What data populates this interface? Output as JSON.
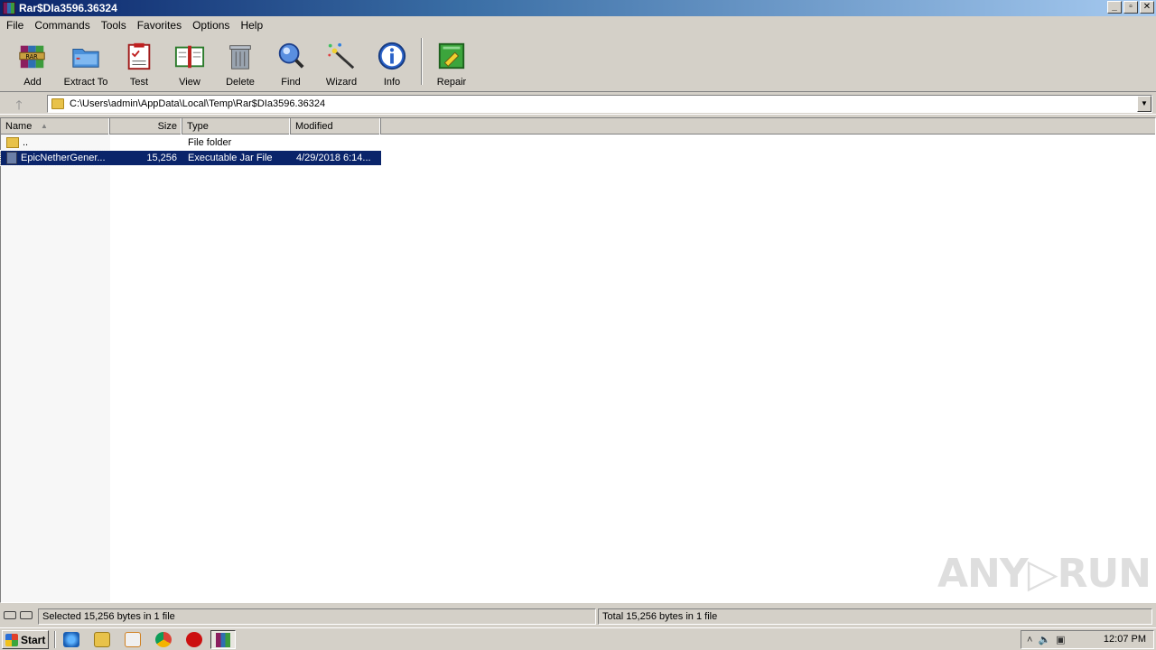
{
  "window": {
    "title": "Rar$DIa3596.36324"
  },
  "window_buttons": {
    "minimize": "_",
    "maximize": "▫",
    "close": "✕"
  },
  "menu": [
    "File",
    "Commands",
    "Tools",
    "Favorites",
    "Options",
    "Help"
  ],
  "toolbar": {
    "add": "Add",
    "extract": "Extract To",
    "test": "Test",
    "view": "View",
    "delete": "Delete",
    "find": "Find",
    "wizard": "Wizard",
    "info": "Info",
    "repair": "Repair"
  },
  "address": {
    "path": "C:\\Users\\admin\\AppData\\Local\\Temp\\Rar$DIa3596.36324"
  },
  "columns": {
    "name": "Name",
    "size": "Size",
    "type": "Type",
    "modified": "Modified"
  },
  "rows": [
    {
      "name": "..",
      "size": "",
      "type": "File folder",
      "modified": ""
    },
    {
      "name": "EpicNetherGener...",
      "size": "15,256",
      "type": "Executable Jar File",
      "modified": "4/29/2018 6:14..."
    }
  ],
  "status": {
    "left": "Selected 15,256 bytes in 1 file",
    "right": "Total 15,256 bytes in 1 file"
  },
  "taskbar": {
    "start": "Start",
    "clock": "12:07 PM"
  },
  "watermark": "ANY▷RUN"
}
